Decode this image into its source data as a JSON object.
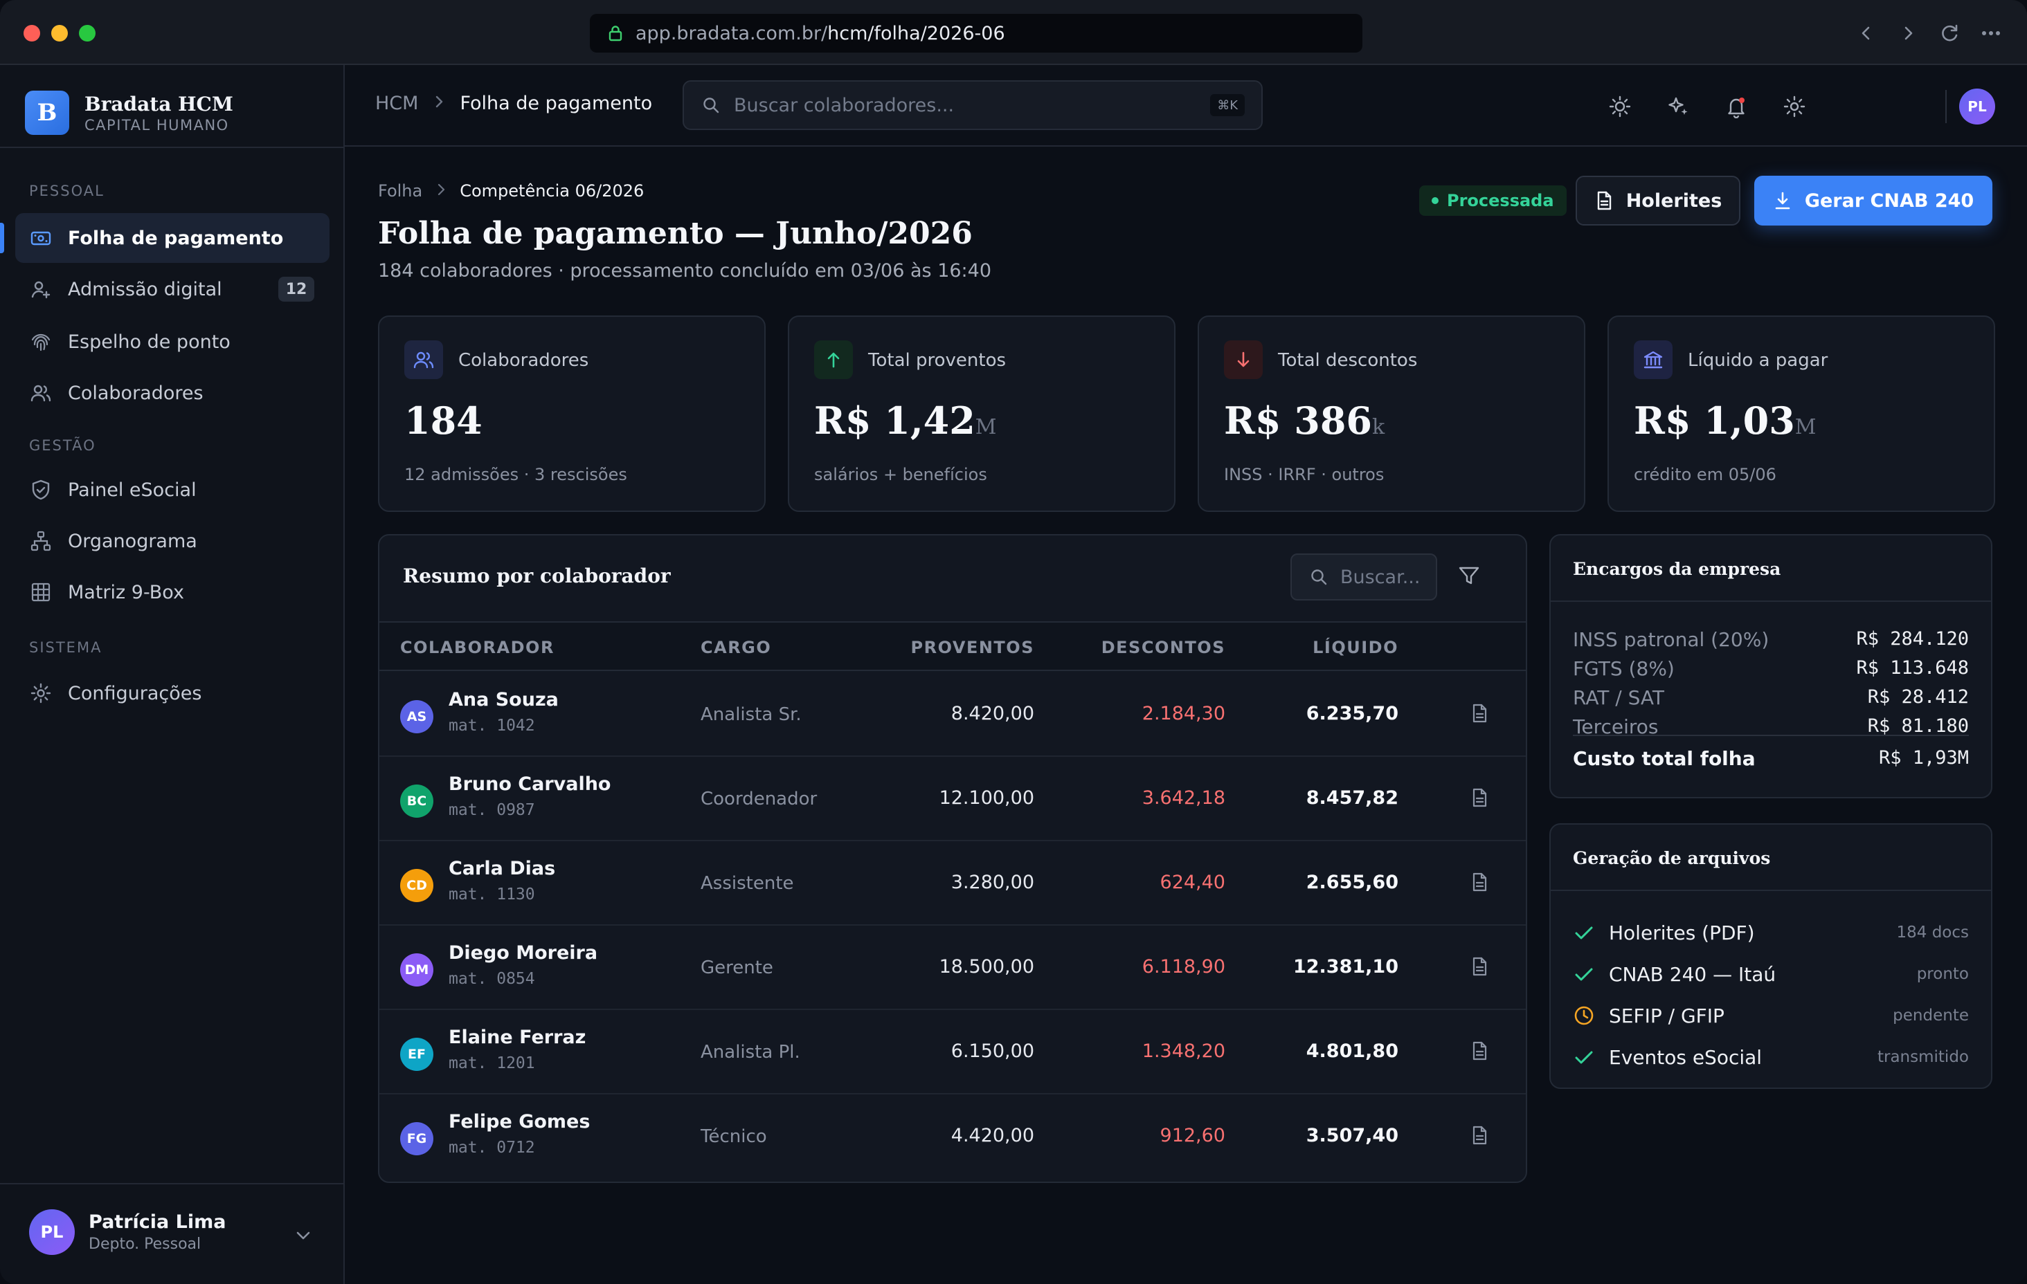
{
  "browser": {
    "url_host": "app.bradata.com.br/",
    "url_path": "hcm/folha/2026-06"
  },
  "brand": {
    "logo_letter": "B",
    "name": "Bradata HCM",
    "subtitle": "CAPITAL HUMANO"
  },
  "sidebar": {
    "sections": [
      {
        "label": "PESSOAL"
      },
      {
        "label": "GESTÃO"
      },
      {
        "label": "SISTEMA"
      }
    ],
    "items": [
      {
        "label": "Folha de pagamento",
        "icon": "payroll-icon",
        "active": true
      },
      {
        "label": "Admissão digital",
        "icon": "user-add-icon",
        "badge": "12"
      },
      {
        "label": "Espelho de ponto",
        "icon": "fingerprint-icon"
      },
      {
        "label": "Colaboradores",
        "icon": "users-icon"
      },
      {
        "label": "Painel eSocial",
        "icon": "shield-check-icon"
      },
      {
        "label": "Organograma",
        "icon": "org-chart-icon"
      },
      {
        "label": "Matriz 9-Box",
        "icon": "grid-icon"
      },
      {
        "label": "Configurações",
        "icon": "gear-icon"
      }
    ],
    "user": {
      "initials": "PL",
      "name": "Patrícia Lima",
      "role": "Depto. Pessoal"
    }
  },
  "topbar": {
    "breadcrumb": [
      "HCM",
      "Folha de pagamento"
    ],
    "search_placeholder": "Buscar colaboradores...",
    "search_shortcut": "⌘K",
    "avatar_initials": "PL"
  },
  "page": {
    "breadcrumb": [
      "Folha",
      "Competência 06/2026"
    ],
    "title": "Folha de pagamento — Junho/2026",
    "subtitle": "184 colaboradores · processamento concluído em 03/06 às 16:40",
    "status": "Processada",
    "btn_payslips": "Holerites",
    "btn_cnab": "Gerar CNAB 240"
  },
  "kpis": [
    {
      "label": "Colaboradores",
      "value": "184",
      "unit": "",
      "sub": "12 admissões · 3 rescisões",
      "icon": "users-icon",
      "color": "#6d8cff"
    },
    {
      "label": "Total proventos",
      "value": "R$ 1,42",
      "unit": "M",
      "sub": "salários + benefícios",
      "icon": "arrow-up-icon",
      "color": "#34d399"
    },
    {
      "label": "Total descontos",
      "value": "R$ 386",
      "unit": "k",
      "sub": "INSS · IRRF · outros",
      "icon": "arrow-down-icon",
      "color": "#f87171"
    },
    {
      "label": "Líquido a pagar",
      "value": "R$ 1,03",
      "unit": "M",
      "sub": "crédito em 05/06",
      "icon": "bank-icon",
      "color": "#7c8cff"
    }
  ],
  "summary": {
    "title": "Resumo por colaborador",
    "search_placeholder": "Buscar...",
    "columns": [
      "COLABORADOR",
      "CARGO",
      "PROVENTOS",
      "DESCONTOS",
      "LÍQUIDO"
    ],
    "rows": [
      {
        "initials": "AS",
        "name": "Ana Souza",
        "mat": "mat. 1042",
        "cargo": "Analista Sr.",
        "proventos": "8.420,00",
        "descontos": "2.184,30",
        "liquido": "6.235,70",
        "color": "#5b63e6"
      },
      {
        "initials": "BC",
        "name": "Bruno Carvalho",
        "mat": "mat. 0987",
        "cargo": "Coordenador",
        "proventos": "12.100,00",
        "descontos": "3.642,18",
        "liquido": "8.457,82",
        "color": "#10a36b"
      },
      {
        "initials": "CD",
        "name": "Carla Dias",
        "mat": "mat. 1130",
        "cargo": "Assistente",
        "proventos": "3.280,00",
        "descontos": "624,40",
        "liquido": "2.655,60",
        "color": "#f59e0b"
      },
      {
        "initials": "DM",
        "name": "Diego Moreira",
        "mat": "mat. 0854",
        "cargo": "Gerente",
        "proventos": "18.500,00",
        "descontos": "6.118,90",
        "liquido": "12.381,10",
        "color": "#8b5cf6"
      },
      {
        "initials": "EF",
        "name": "Elaine Ferraz",
        "mat": "mat. 1201",
        "cargo": "Analista Pl.",
        "proventos": "6.150,00",
        "descontos": "1.348,20",
        "liquido": "4.801,80",
        "color": "#0ea5c6"
      },
      {
        "initials": "FG",
        "name": "Felipe Gomes",
        "mat": "mat. 0712",
        "cargo": "Técnico",
        "proventos": "4.420,00",
        "descontos": "912,60",
        "liquido": "3.507,40",
        "color": "#5b63e6"
      }
    ]
  },
  "encargos": {
    "title": "Encargos da empresa",
    "rows": [
      {
        "label": "INSS patronal (20%)",
        "value": "R$ 284.120"
      },
      {
        "label": "FGTS (8%)",
        "value": "R$ 113.648"
      },
      {
        "label": "RAT / SAT",
        "value": "R$ 28.412"
      },
      {
        "label": "Terceiros",
        "value": "R$ 81.180"
      }
    ],
    "total_label": "Custo total folha",
    "total_value": "R$ 1,93M"
  },
  "files": {
    "title": "Geração de arquivos",
    "rows": [
      {
        "label": "Holerites (PDF)",
        "meta": "184 docs",
        "status": "done"
      },
      {
        "label": "CNAB 240 — Itaú",
        "meta": "pronto",
        "status": "done"
      },
      {
        "label": "SEFIP / GFIP",
        "meta": "pendente",
        "status": "pending"
      },
      {
        "label": "Eventos eSocial",
        "meta": "transmitido",
        "status": "done"
      }
    ]
  }
}
